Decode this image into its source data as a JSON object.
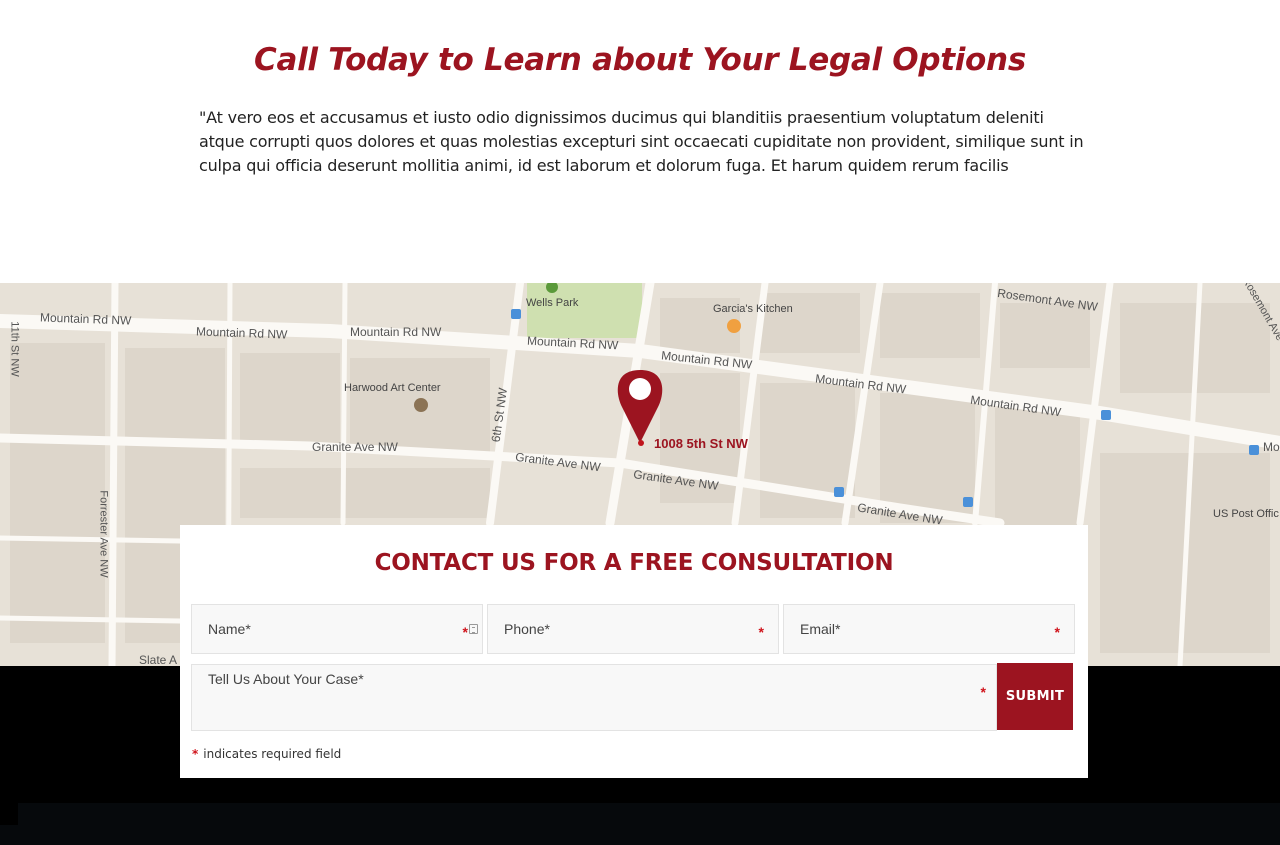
{
  "intro": {
    "headline": "Call Today to Learn about Your Legal Options",
    "body": "\"At vero eos et accusamus et iusto odio dignissimos ducimus qui blanditiis praesentium voluptatum deleniti atque corrupti quos dolores et quas molestias excepturi sint occaecati cupiditate non provident, similique sunt in culpa qui officia deserunt mollitia animi, id est laborum et dolorum fuga. Et harum quidem rerum facilis"
  },
  "map": {
    "pin_address": "1008 5th St NW",
    "streets": {
      "mountain_1": "Mountain Rd NW",
      "mountain_2": "Mountain Rd NW",
      "mountain_3": "Mountain Rd NW",
      "mountain_4": "Mountain Rd NW",
      "mountain_5": "Mountain Rd NW",
      "mountain_6": "Mountain Rd NW",
      "mountain_7": "Mountain Rd NW",
      "mountain_edge": "Mo",
      "granite_1": "Granite Ave NW",
      "granite_2": "Granite Ave NW",
      "granite_3": "Granite Ave NW",
      "granite_4": "Granite Ave NW",
      "rosemont": "Rosemont Ave NW",
      "rosemont_edge": "Rosemont Ave",
      "eleventh": "11th St NW",
      "sixth": "6th St NW",
      "forrester": "Forrester Ave NW",
      "slate": "Slate A"
    },
    "pois": {
      "park": "Wells Park",
      "restaurant": "Garcia's Kitchen",
      "art_center": "Harwood Art Center",
      "post_office": "US Post Offic"
    }
  },
  "form": {
    "title": "CONTACT US FOR A FREE CONSULTATION",
    "name_placeholder": "Name*",
    "phone_placeholder": "Phone*",
    "email_placeholder": "Email*",
    "case_placeholder": "Tell Us About Your Case*",
    "required_marker": "*",
    "submit_label": "SUBMIT",
    "required_note": "indicates required field"
  },
  "colors": {
    "brand": "#9c1420",
    "required": "#d0141c"
  }
}
